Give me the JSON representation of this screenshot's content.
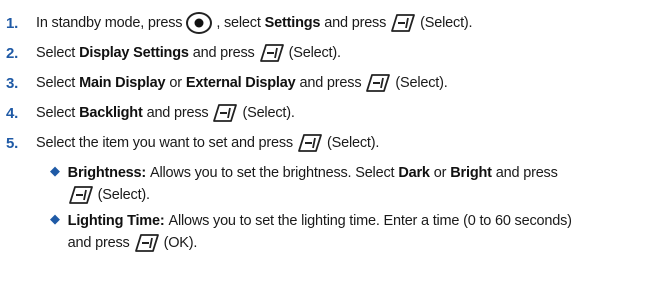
{
  "steps": [
    {
      "num": "1.",
      "parts": [
        "In standby mode, press",
        ", select",
        "Settings",
        "and press",
        "(Select)."
      ]
    },
    {
      "num": "2.",
      "parts": [
        "Select",
        "Display Settings",
        "and press",
        "(Select)."
      ]
    },
    {
      "num": "3.",
      "parts": [
        "Select",
        "Main Display",
        "or",
        "External Display",
        "and press",
        "(Select)."
      ]
    },
    {
      "num": "4.",
      "parts": [
        "Select",
        "Backlight",
        "and press",
        "(Select)."
      ]
    },
    {
      "num": "5.",
      "parts": [
        "Select the item you want to set and press",
        "(Select)."
      ]
    }
  ],
  "bullets": [
    {
      "term": "Brightness:",
      "line1": [
        "Allows you to set the brightness. Select",
        "Dark",
        "or",
        "Bright",
        "and press"
      ],
      "line2": [
        "(Select)."
      ]
    },
    {
      "term": "Lighting Time:",
      "line1": [
        "Allows you to set the lighting time. Enter a time (0 to 60 seconds)"
      ],
      "line2": [
        "and press",
        "(OK)."
      ]
    }
  ],
  "icons": {
    "home_key": "home-key-icon",
    "soft_key": "left-soft-key-icon"
  }
}
